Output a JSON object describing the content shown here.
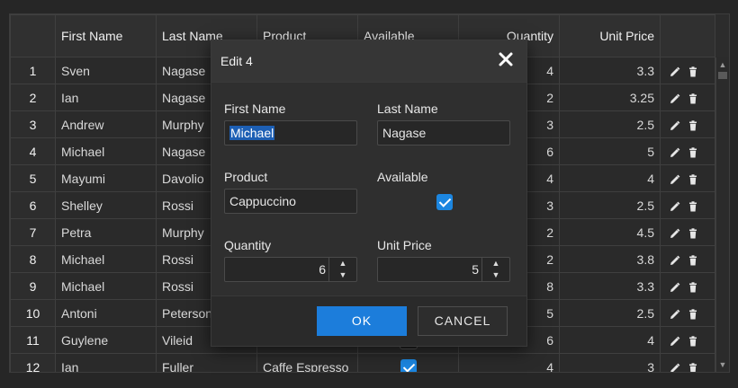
{
  "grid": {
    "columns": [
      "",
      "First Name",
      "Last Name",
      "Product",
      "Available",
      "Quantity",
      "Unit Price",
      ""
    ],
    "rows": [
      {
        "n": "1",
        "first": "Sven",
        "last": "Nagase",
        "product": "",
        "available": false,
        "qty": "4",
        "price": "3.3"
      },
      {
        "n": "2",
        "first": "Ian",
        "last": "Nagase",
        "product": "",
        "available": false,
        "qty": "2",
        "price": "3.25"
      },
      {
        "n": "3",
        "first": "Andrew",
        "last": "Murphy",
        "product": "",
        "available": false,
        "qty": "3",
        "price": "2.5"
      },
      {
        "n": "4",
        "first": "Michael",
        "last": "Nagase",
        "product": "",
        "available": false,
        "qty": "6",
        "price": "5"
      },
      {
        "n": "5",
        "first": "Mayumi",
        "last": "Davolio",
        "product": "",
        "available": false,
        "qty": "4",
        "price": "4"
      },
      {
        "n": "6",
        "first": "Shelley",
        "last": "Rossi",
        "product": "",
        "available": false,
        "qty": "3",
        "price": "2.5"
      },
      {
        "n": "7",
        "first": "Petra",
        "last": "Murphy",
        "product": "",
        "available": false,
        "qty": "2",
        "price": "4.5"
      },
      {
        "n": "8",
        "first": "Michael",
        "last": "Rossi",
        "product": "",
        "available": false,
        "qty": "2",
        "price": "3.8"
      },
      {
        "n": "9",
        "first": "Michael",
        "last": "Rossi",
        "product": "",
        "available": false,
        "qty": "8",
        "price": "3.3"
      },
      {
        "n": "10",
        "first": "Antoni",
        "last": "Peterson",
        "product": "",
        "available": false,
        "qty": "5",
        "price": "2.5"
      },
      {
        "n": "11",
        "first": "Guylene",
        "last": "Vileid",
        "product": "",
        "available": false,
        "qty": "6",
        "price": "4"
      },
      {
        "n": "12",
        "first": "Ian",
        "last": "Fuller",
        "product": "Caffe Espresso",
        "available": true,
        "qty": "4",
        "price": "3"
      }
    ]
  },
  "dialog": {
    "title": "Edit 4",
    "first_name_label": "First Name",
    "first_name_value": "Michael",
    "last_name_label": "Last Name",
    "last_name_value": "Nagase",
    "product_label": "Product",
    "product_value": "Cappuccino",
    "available_label": "Available",
    "available_checked": true,
    "quantity_label": "Quantity",
    "quantity_value": "6",
    "unit_price_label": "Unit Price",
    "unit_price_value": "5",
    "ok_label": "OK",
    "cancel_label": "CANCEL"
  },
  "colors": {
    "accent": "#1c7ddb",
    "background": "#262626",
    "selection": "#1d5fb4"
  },
  "icons": {
    "edit": "pencil-icon",
    "delete": "trash-icon",
    "close": "close-icon",
    "spin_up": "chevron-up-icon",
    "spin_down": "chevron-down-icon"
  }
}
